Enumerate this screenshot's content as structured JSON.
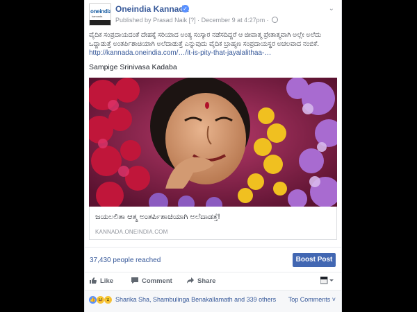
{
  "post": {
    "page_name": "Oneindia Kannada",
    "logo_text": "oneindia",
    "logo_subtext": "kannada",
    "published_prefix": "Published by",
    "publisher": "Prasad Naik",
    "publisher_suffix": "[?]",
    "date_text": "· December 9 at 4:27pm ·",
    "text_line1": "ವೈದಿಕ ಸಂಪ್ರದಾಯದಂತೆ ದೇಹಕ್ಕೆ ಸರಿಯಾದ ಅಂತ್ಯ ಸಂಸ್ಕಾರ ನಡೆಸದಿದ್ದರೆ ಆ ಜೀವಾತ್ಮ ಪ್ರೇತಾತ್ಮವಾಗಿ ಅಲ್ಲೇ ಅಲೆದು",
    "text_line2": "ಒದ್ದಾಡುತ್ತೆ ಅಂತರ್ಪಿಶಾಚಿಯಾಗಿ ಅಲೆದಾಡುತ್ತೆ ಎನ್ನುವುದು ವೈದಿಕ ಬ್ರಾಹ್ಮಣ ಸಂಪ್ರದಾಯಸ್ಥರ ಅಚಲವಾದ ನಂಬಿಕೆ.",
    "link_url": "http://kannada.oneindia.com/…/it-is-pity-that-jayalalithaa-…",
    "author": "Sampige Srinivasa Kadaba",
    "link_title": "ಜಯಲಲಿತಾ ಆತ್ಮ ಅಂತರ್ಪಿಶಾಚಿಯಾಗಿ ಅಲೆದಾಡತ್ತೆ!",
    "link_domain": "KANNADA.ONEINDIA.COM"
  },
  "stats": {
    "reached": "37,430 people reached",
    "boost_label": "Boost Post"
  },
  "actions": {
    "like": "Like",
    "comment": "Comment",
    "share": "Share"
  },
  "reactions": {
    "names": "Sharika Sha, Shambulinga Benakallamath and 339 others",
    "top_comments": "Top Comments ˅"
  },
  "colors": {
    "brand_link": "#365899",
    "boost": "#4267b2",
    "meta": "#90949c"
  },
  "icons": [
    "verified-icon",
    "globe-icon",
    "chevron-down-icon",
    "like-icon",
    "comment-icon",
    "share-icon",
    "viewer-icon",
    "like-reaction-icon",
    "haha-reaction-icon",
    "wow-reaction-icon"
  ]
}
